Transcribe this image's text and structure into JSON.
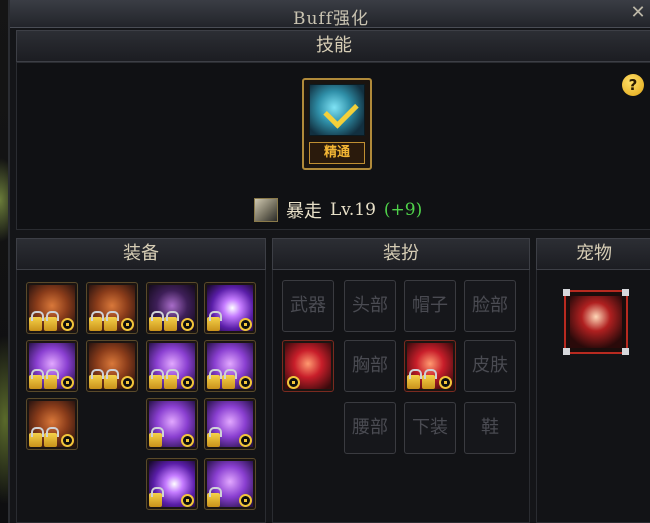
{
  "window": {
    "title": "Buff强化",
    "close_label": "✕"
  },
  "skill_section": {
    "header": "技能",
    "mastery_label": "精通",
    "help_label": "?",
    "skill_name": "暴走",
    "level": "Lv.19",
    "bonus": "(+9)"
  },
  "equipment": {
    "header": "装备"
  },
  "avatar": {
    "header": "装扮",
    "slots": {
      "weapon": "武器",
      "head": "头部",
      "hat": "帽子",
      "face": "脸部",
      "chest": "胸部",
      "skin": "皮肤",
      "waist": "腰部",
      "lower": "下装",
      "shoes": "鞋"
    }
  },
  "pet": {
    "header": "宠物"
  },
  "colors": {
    "bonus_green": "#4fd24a",
    "mastery_gold": "#f2b534",
    "pet_frame_red": "#b82a20"
  },
  "icons": {
    "equipment": "gear-item-icon",
    "lock": "lock-icon",
    "swap": "swap-icon",
    "help": "question-icon",
    "close": "close-icon"
  }
}
